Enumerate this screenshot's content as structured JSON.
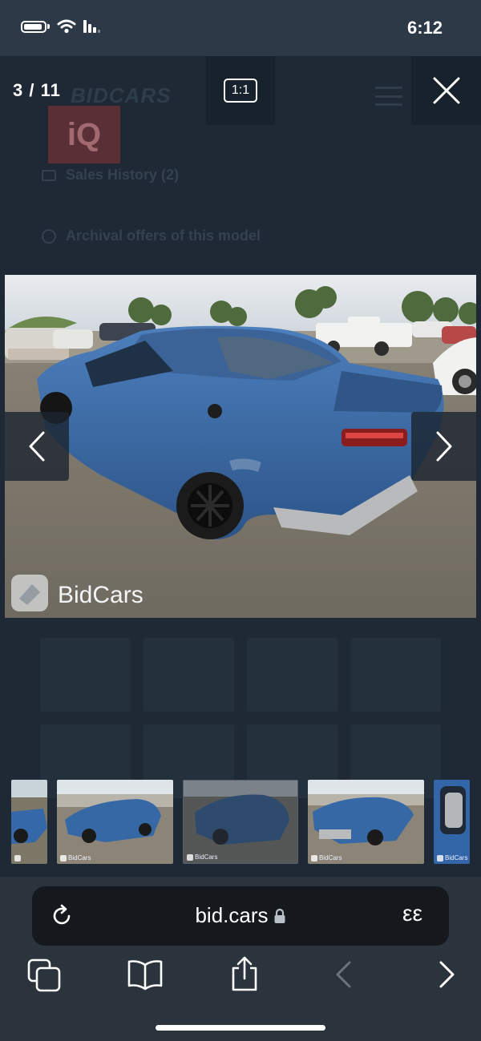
{
  "status_bar": {
    "time": "6:12"
  },
  "background_page": {
    "logo": "BIDCARS",
    "badge": "iQ",
    "sales_history": "Sales History (2)",
    "archival_offers": "Archival offers of this model"
  },
  "viewer": {
    "counter": "3 / 11",
    "ratio_label": "1:1",
    "watermark": "BidCars",
    "thumb_watermark": "BidCars"
  },
  "browser": {
    "url": "bid.cars",
    "reader_label": "εε"
  },
  "colors": {
    "car_blue": "#3a6aa8",
    "browser_bar": "#2b333d",
    "url_pill": "#15191e"
  }
}
